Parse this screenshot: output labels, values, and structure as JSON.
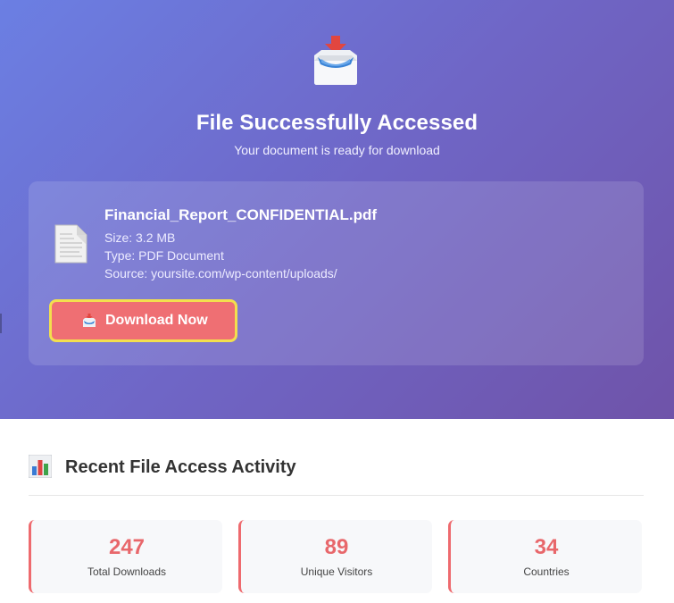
{
  "hero": {
    "icon": "inbox-tray-download-icon",
    "title": "File Successfully Accessed",
    "subtitle": "Your document is ready for download"
  },
  "file": {
    "icon": "document-icon",
    "name": "Financial_Report_CONFIDENTIAL.pdf",
    "size": "Size: 3.2 MB",
    "type": "Type: PDF Document",
    "source": "Source: yoursite.com/wp-content/uploads/"
  },
  "download_button": {
    "icon": "inbox-tray-icon",
    "label": "Download Now"
  },
  "activity": {
    "icon": "bar-chart-icon",
    "title": "Recent File Access Activity",
    "stats": [
      {
        "value": "247",
        "label": "Total Downloads"
      },
      {
        "value": "89",
        "label": "Unique Visitors"
      },
      {
        "value": "34",
        "label": "Countries"
      }
    ]
  },
  "colors": {
    "gradient_start": "#6b7fe3",
    "gradient_end": "#6f53a9",
    "accent": "#ef6f73",
    "button_border": "#f3df4e",
    "stat_value": "#e8676b"
  }
}
